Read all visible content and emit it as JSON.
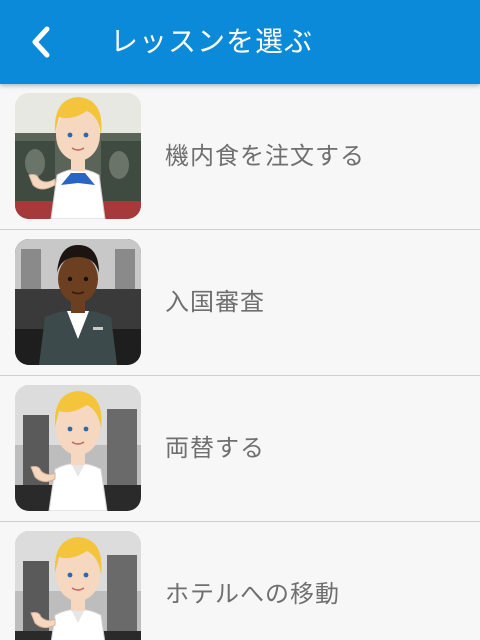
{
  "header": {
    "title": "レッスンを選ぶ",
    "back_icon": "chevron-left-icon"
  },
  "lessons": [
    {
      "label": "機内食を注文する",
      "avatar": "flight-attendant"
    },
    {
      "label": "入国審査",
      "avatar": "immigration-officer"
    },
    {
      "label": "両替する",
      "avatar": "clerk"
    },
    {
      "label": "ホテルへの移動",
      "avatar": "clerk"
    }
  ],
  "colors": {
    "appbar": "#0a8ad8",
    "label_text": "#6f6f6f",
    "divider": "#cfcfcf",
    "background": "#f7f7f7"
  }
}
